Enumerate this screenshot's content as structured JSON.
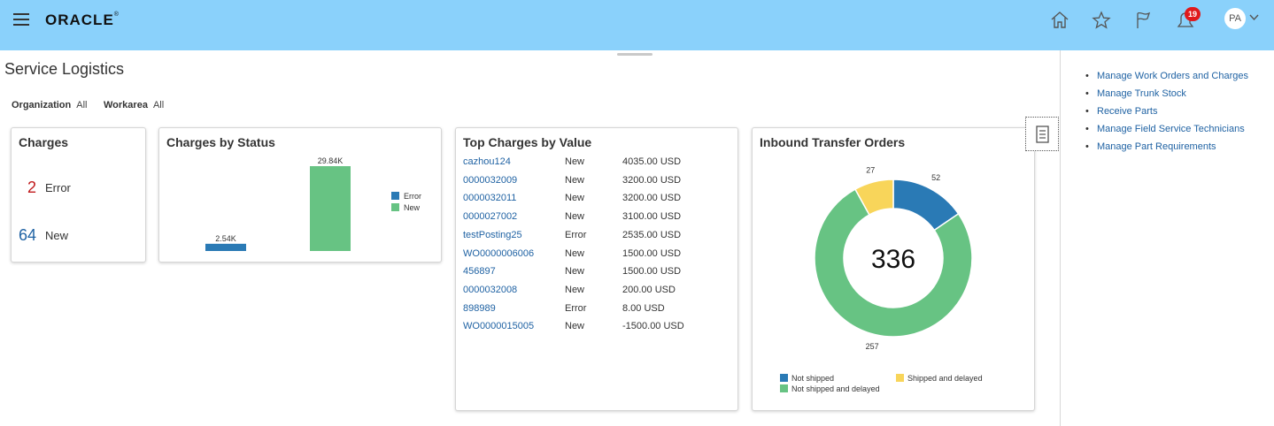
{
  "header": {
    "logo_text": "ORACLE",
    "notification_count": "19",
    "user_initials": "PA"
  },
  "page": {
    "title": "Service Logistics"
  },
  "filters": [
    {
      "label": "Organization",
      "value": "All"
    },
    {
      "label": "Workarea",
      "value": "All"
    }
  ],
  "charges_card": {
    "title": "Charges",
    "items": [
      {
        "count": "2",
        "label": "Error",
        "color": "#c0191b"
      },
      {
        "count": "64",
        "label": "New",
        "color": "#1f62a3"
      }
    ]
  },
  "charges_by_status": {
    "title": "Charges by Status",
    "chart_data": {
      "type": "bar",
      "categories": [
        "Error",
        "New"
      ],
      "values": [
        2540,
        29840
      ],
      "data_labels": [
        "2.54K",
        "29.84K"
      ],
      "legend": [
        {
          "name": "Error",
          "color": "#2a7ab5"
        },
        {
          "name": "New",
          "color": "#67c383"
        }
      ],
      "legend_position": "right",
      "grid": false
    }
  },
  "top_charges": {
    "title": "Top Charges by Value",
    "rows": [
      {
        "id": "cazhou124",
        "status": "New",
        "value": "4035.00 USD"
      },
      {
        "id": "0000032009",
        "status": "New",
        "value": "3200.00 USD"
      },
      {
        "id": "0000032011",
        "status": "New",
        "value": "3200.00 USD"
      },
      {
        "id": "0000027002",
        "status": "New",
        "value": "3100.00 USD"
      },
      {
        "id": "testPosting25",
        "status": "Error",
        "value": "2535.00 USD"
      },
      {
        "id": "WO0000006006",
        "status": "New",
        "value": "1500.00 USD"
      },
      {
        "id": "456897",
        "status": "New",
        "value": "1500.00 USD"
      },
      {
        "id": "0000032008",
        "status": "New",
        "value": "200.00 USD"
      },
      {
        "id": "898989",
        "status": "Error",
        "value": "8.00 USD"
      },
      {
        "id": "WO0000015005",
        "status": "New",
        "value": "-1500.00 USD"
      }
    ]
  },
  "inbound_transfer": {
    "title": "Inbound Transfer Orders",
    "center_label": "336",
    "chart_data": {
      "type": "pie",
      "categories": [
        "Not shipped",
        "Not shipped and delayed",
        "Shipped and delayed"
      ],
      "values": [
        52,
        257,
        27
      ],
      "data_labels": [
        "52",
        "257",
        "27"
      ],
      "colors": [
        "#2a7ab5",
        "#67c383",
        "#f8d55a"
      ],
      "legend_position": "bottom"
    },
    "legend": [
      {
        "name": "Not shipped",
        "color": "#2a7ab5"
      },
      {
        "name": "Shipped and delayed",
        "color": "#f8d55a"
      },
      {
        "name": "Not shipped and delayed",
        "color": "#67c383"
      }
    ]
  },
  "side_links": [
    "Manage Work Orders and Charges",
    "Manage Trunk Stock",
    "Receive Parts",
    "Manage Field Service Technicians",
    "Manage Part Requirements"
  ]
}
